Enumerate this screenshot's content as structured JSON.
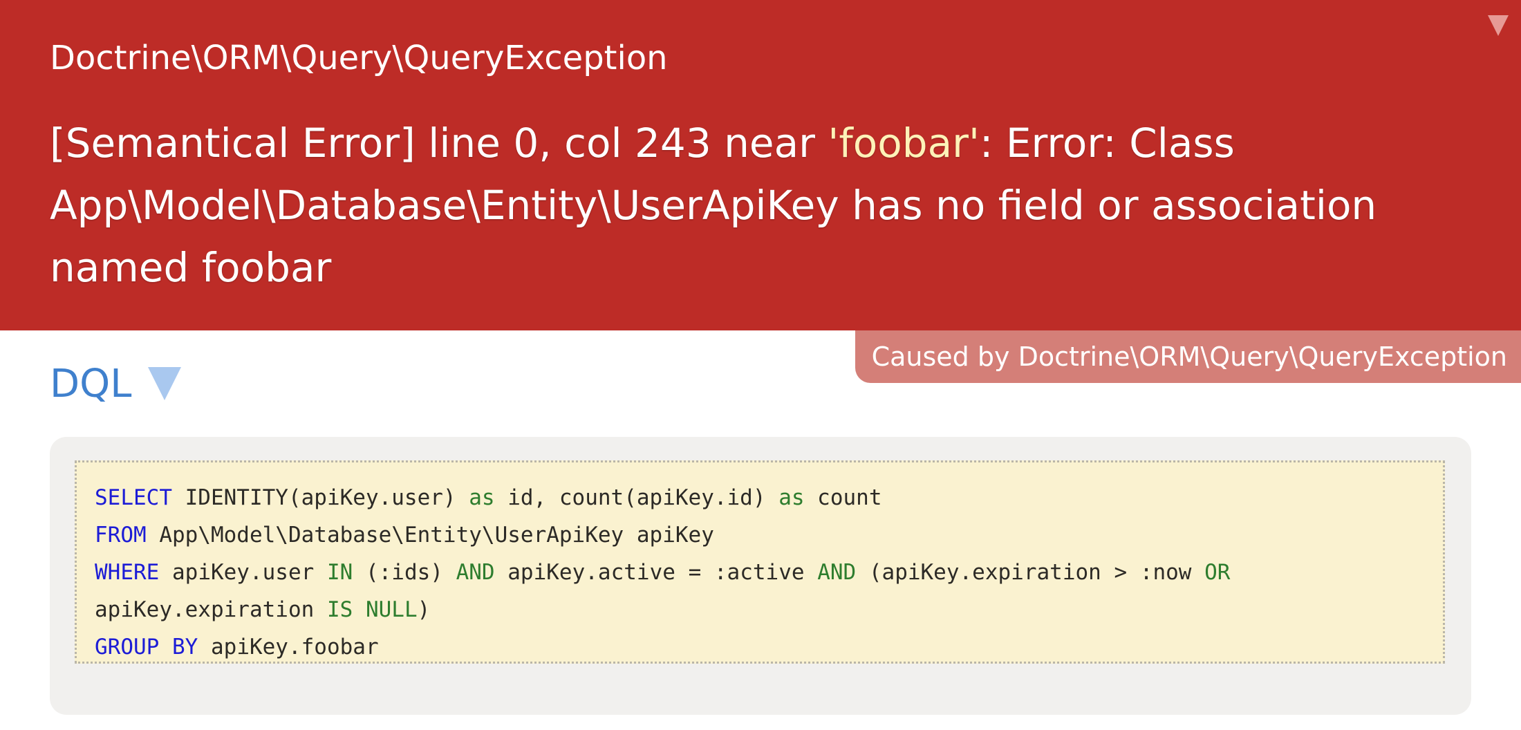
{
  "exception": {
    "class_name": "Doctrine\\ORM\\Query\\QueryException",
    "message_before": "[Semantical Error] line 0, col 243 near ",
    "message_highlight": "'foobar'",
    "message_after": ": Error: Class App\\Model\\Database\\Entity\\UserApiKey has no field or association named foobar"
  },
  "caused_by": {
    "label": "Caused by Doctrine\\ORM\\Query\\QueryException"
  },
  "section": {
    "title": "DQL"
  },
  "dql": {
    "l1_kw1": "SELECT",
    "l1_t1": " IDENTITY(apiKey.user) ",
    "l1_op1": "as",
    "l1_t2": " id, count(apiKey.id) ",
    "l1_op2": "as",
    "l1_t3": " count",
    "l2_kw1": "FROM",
    "l2_t1": " App\\Model\\Database\\Entity\\UserApiKey apiKey",
    "l3_kw1": "WHERE",
    "l3_t1": " apiKey.user ",
    "l3_op1": "IN",
    "l3_t2": " (:ids) ",
    "l3_op2": "AND",
    "l3_t3": " apiKey.active = :active ",
    "l3_op3": "AND",
    "l3_t4": " (apiKey.expiration > :now ",
    "l3_op4": "OR",
    "l4_t1": "apiKey.expiration ",
    "l4_op1": "IS",
    "l4_t2": " ",
    "l4_op2": "NULL",
    "l4_t3": ")",
    "l5_kw1": "GROUP",
    "l5_t1": " ",
    "l5_kw2": "BY",
    "l5_t2": " apiKey.foobar"
  },
  "icons": {
    "header_toggle": "triangle-down-icon",
    "section_toggle": "triangle-down-icon"
  },
  "colors": {
    "header_bg": "#bd2c27",
    "caused_by_bg": "#d47f78",
    "highlight": "#fdf2b8",
    "section_title": "#3f80cd",
    "code_bg": "#faf2d0",
    "keyword": "#1c1cd6",
    "operator": "#2e7d2e"
  }
}
